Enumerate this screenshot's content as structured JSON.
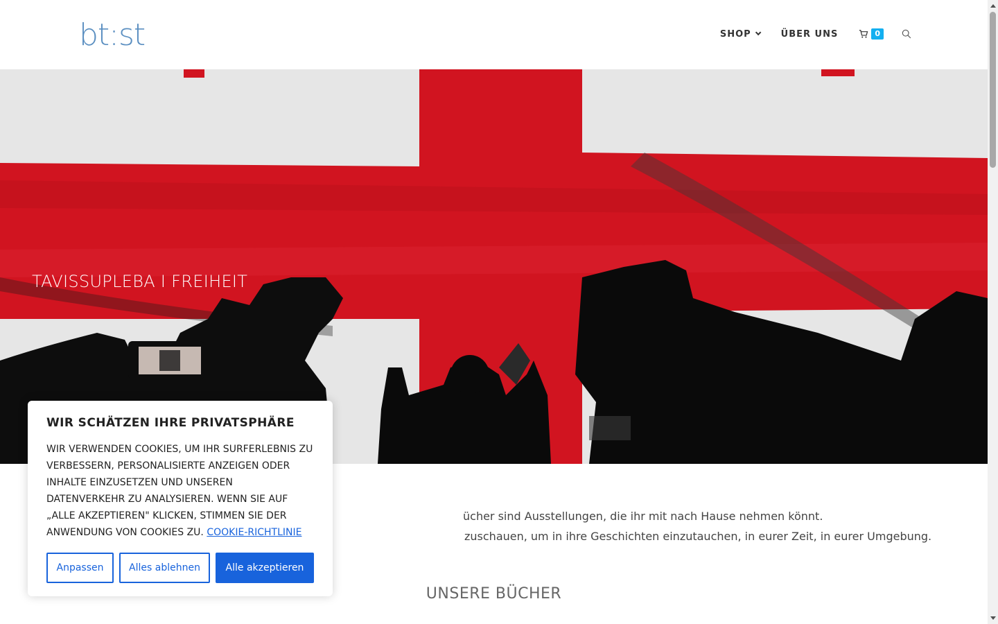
{
  "header": {
    "logo": "bt:st",
    "nav": {
      "shop": "SHOP",
      "about": "ÜBER UNS"
    },
    "cart_count": "0"
  },
  "hero": {
    "title": "TAVISSUPLEBA I FREIHEIT"
  },
  "intro": {
    "line1": "ücher sind Ausstellungen, die ihr mit nach Hause nehmen könnt.",
    "line2": "zuschauen, um in ihre Geschichten einzutauchen, in eurer Zeit, in eurer Umgebung."
  },
  "section_title": "UNSERE BÜCHER",
  "cookie": {
    "title": "WIR SCHÄTZEN IHRE PRIVATSPHÄRE",
    "text": "WIR VERWENDEN COOKIES, UM IHR SURFERLEBNIS ZU VERBESSERN, PERSONALISIERTE ANZEIGEN ODER INHALTE EINZUSETZEN UND UNSEREN DATENVERKEHR ZU ANALYSIEREN. WENN SIE AUF „ALLE AKZEPTIEREN\" KLICKEN, STIMMEN SIE DER ANWENDUNG VON COOKIES ZU.",
    "link": "COOKIE-RICHTLINIE",
    "btn_customize": "Anpassen",
    "btn_reject": "Alles ablehnen",
    "btn_accept": "Alle akzeptieren"
  },
  "colors": {
    "accent": "#1863dc",
    "cart_badge": "#13aff0",
    "logo": "#5b8fc1",
    "flag_red": "#d11420"
  },
  "icons": [
    "chevron-down-icon",
    "cart-icon",
    "search-icon"
  ]
}
